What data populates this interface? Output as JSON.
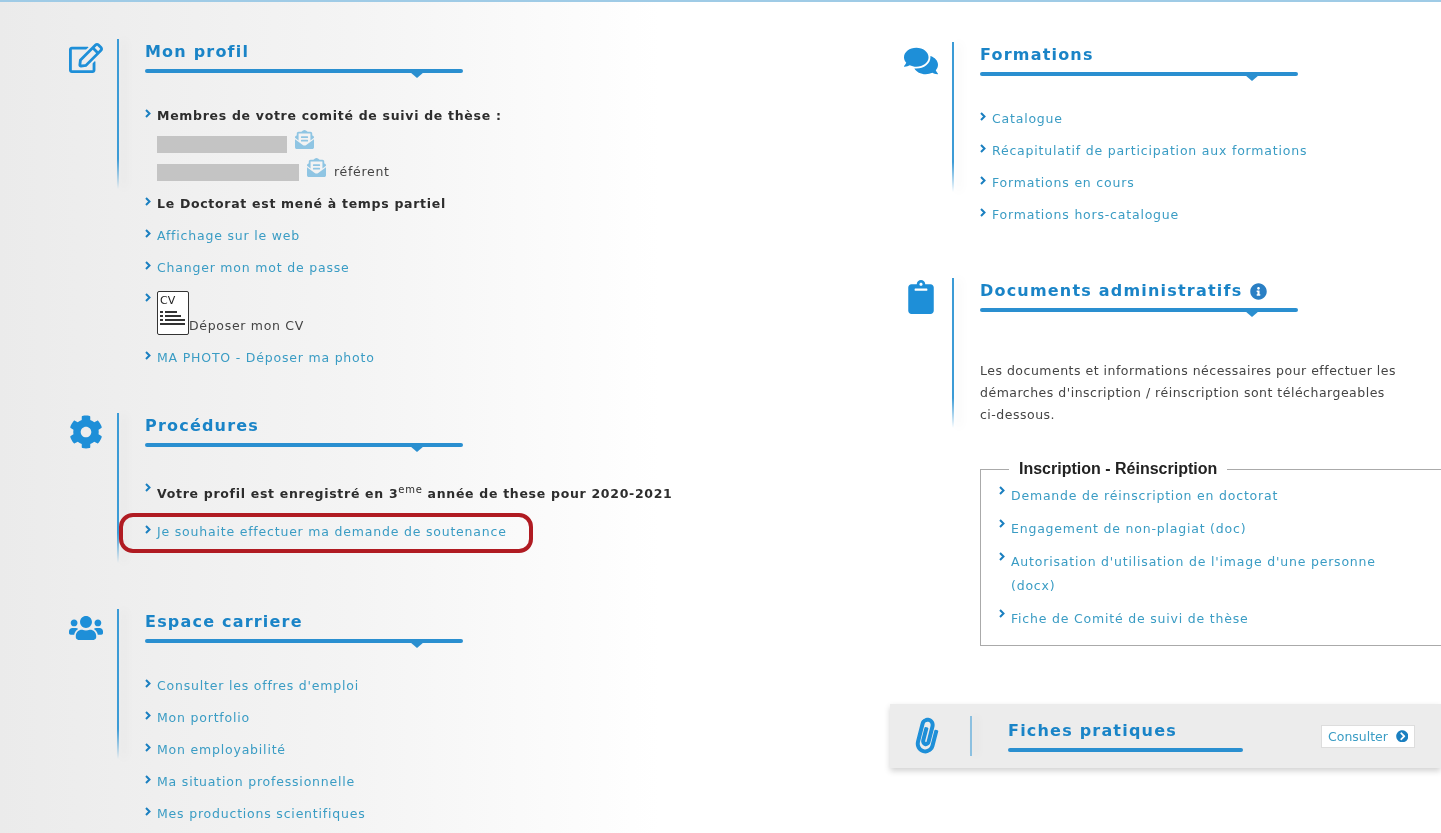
{
  "left_sections": [
    {
      "title": "Mon profil",
      "items": [
        {
          "kind": "members",
          "text": "Membres de votre comité de suivi de thèse :",
          "members": [
            {
              "redacted": true
            },
            {
              "redacted": true,
              "note": "référent"
            }
          ]
        },
        {
          "kind": "bold",
          "text": "Le Doctorat est mené à temps partiel"
        },
        {
          "kind": "link",
          "text": "Affichage sur le web"
        },
        {
          "kind": "link",
          "text": "Changer mon mot de passe"
        },
        {
          "kind": "cv",
          "icon_label": "CV",
          "text": "Déposer mon CV"
        },
        {
          "kind": "link",
          "text": "MA PHOTO - Déposer ma photo"
        }
      ]
    },
    {
      "title": "Procédures",
      "items": [
        {
          "kind": "bold",
          "text": "Votre profil est enregistré en 3$^{eme}$ année de these pour 2020-2021",
          "highlighted": false
        },
        {
          "kind": "link",
          "text": "Je souhaite effectuer ma demande de soutenance",
          "highlighted": true
        }
      ]
    },
    {
      "title": "Espace carriere",
      "items": [
        {
          "kind": "link",
          "text": "Consulter les offres d'emploi"
        },
        {
          "kind": "link",
          "text": "Mon portfolio"
        },
        {
          "kind": "link",
          "text": "Mon employabilité"
        },
        {
          "kind": "link",
          "text": "Ma situation professionnelle"
        },
        {
          "kind": "link",
          "text": "Mes productions scientifiques"
        }
      ]
    }
  ],
  "right_sections": [
    {
      "title": "Formations",
      "items": [
        {
          "kind": "link",
          "text": "Catalogue"
        },
        {
          "kind": "link",
          "text": "Récapitulatif de participation aux formations"
        },
        {
          "kind": "link",
          "text": "Formations en cours"
        },
        {
          "kind": "link",
          "text": "Formations hors-catalogue"
        }
      ]
    },
    {
      "title": "Documents administratifs",
      "info": true,
      "description": "Les documents et informations nécessaires pour effectuer les démarches d'inscription / réinscription sont téléchargeables ci-dessous.",
      "fieldset": {
        "legend": "Inscription - Réinscription",
        "items": [
          {
            "kind": "link",
            "text": "Demande de réinscription en doctorat"
          },
          {
            "kind": "link",
            "text": "Engagement de non-plagiat (doc)"
          },
          {
            "kind": "link",
            "text": "Autorisation d'utilisation de l'image d'une personne (docx)"
          },
          {
            "kind": "link",
            "text": "Fiche de Comité de suivi de thèse"
          }
        ]
      }
    }
  ],
  "fiches": {
    "title": "Fiches pratiques",
    "button": "Consulter"
  }
}
